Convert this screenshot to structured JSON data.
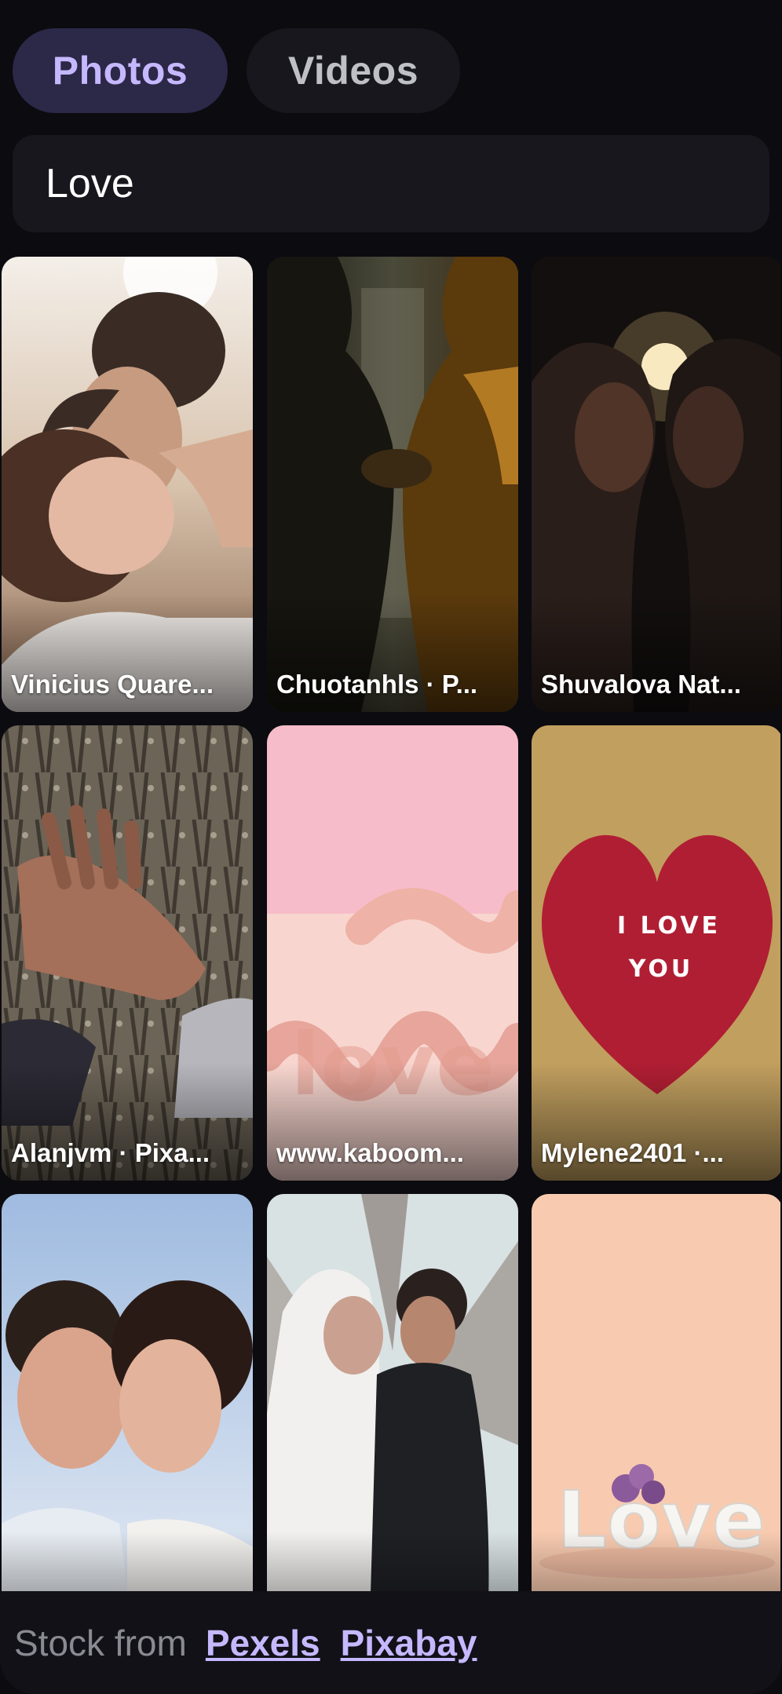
{
  "tabs": {
    "photos_label": "Photos",
    "videos_label": "Videos",
    "active": "Photos"
  },
  "search": {
    "value": "Love"
  },
  "results": [
    {
      "credit": "Vinicius Quare..."
    },
    {
      "credit": "Chuotanhls · P..."
    },
    {
      "credit": "Shuvalova Nat..."
    },
    {
      "credit": "Alanjvm · Pixa..."
    },
    {
      "credit": "www.kaboom..."
    },
    {
      "credit": "Mylene2401 ·..."
    },
    {
      "credit": ""
    },
    {
      "credit": ""
    },
    {
      "credit": ""
    }
  ],
  "photo_text": {
    "heart_line1": "I LOVE",
    "heart_line2": "YOU",
    "balloon_word": "love",
    "block_word": "Love"
  },
  "footer": {
    "label": "Stock from",
    "link1": "Pexels",
    "link2": "Pixabay"
  },
  "colors": {
    "accent": "#c6b8ff",
    "active_tab_bg": "#2c2847",
    "background": "#0b0b10"
  }
}
